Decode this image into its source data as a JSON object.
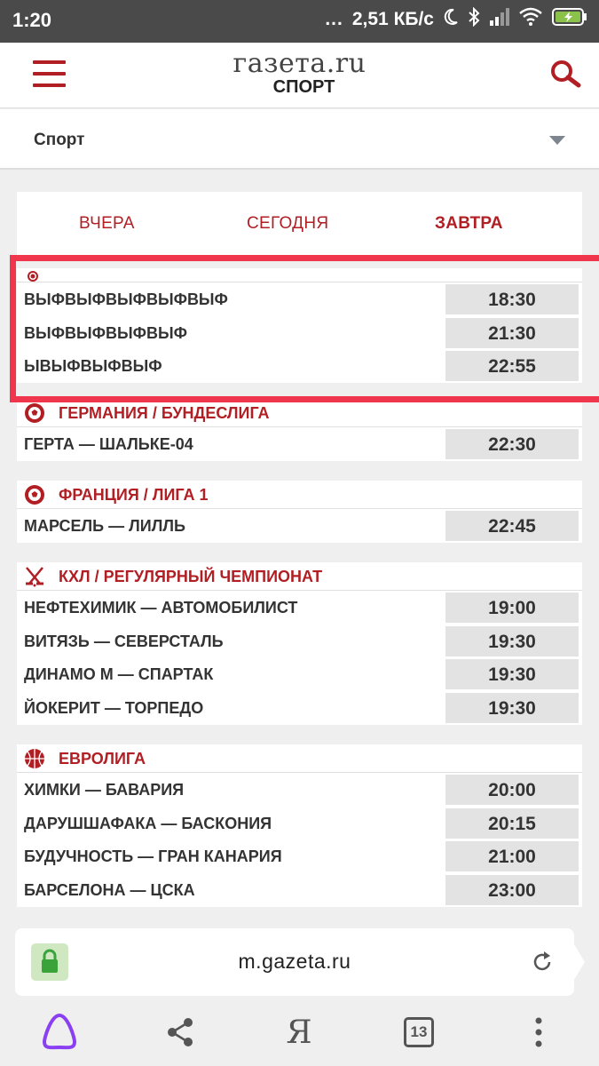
{
  "status_bar": {
    "time": "1:20",
    "dots": "...",
    "speed": "2,51 КБ/с",
    "icons": [
      "moon-icon",
      "bluetooth-icon",
      "signal-icon",
      "wifi-icon",
      "battery-charging-icon"
    ]
  },
  "header": {
    "logo_main": "газета.ru",
    "logo_sub": "СПОРТ",
    "menu_icon": "hamburger-icon",
    "search_icon": "search-icon",
    "brand_color": "#b11f24"
  },
  "category": {
    "selected": "Спорт"
  },
  "tabs": [
    {
      "label": "ВЧЕРА",
      "active": false
    },
    {
      "label": "СЕГОДНЯ",
      "active": false
    },
    {
      "label": "ЗАВТРА",
      "active": true
    }
  ],
  "blocks": [
    {
      "title": "",
      "icon": "soccer-ball-icon",
      "matches": [
        {
          "name": "ВЫФВЫФВЫФВЫФВЫФ",
          "time": "18:30"
        },
        {
          "name": "ВЫФВЫФВЫФВЫФ",
          "time": "21:30"
        },
        {
          "name": "ЫВЫФВЫФВЫФ",
          "time": "22:55"
        }
      ]
    },
    {
      "title": "ГЕРМАНИЯ / БУНДЕСЛИГА",
      "icon": "soccer-ball-icon",
      "matches": [
        {
          "name": "ГЕРТА — ШАЛЬКЕ-04",
          "time": "22:30"
        }
      ]
    },
    {
      "title": "ФРАНЦИЯ / ЛИГА 1",
      "icon": "soccer-ball-icon",
      "matches": [
        {
          "name": "МАРСЕЛЬ — ЛИЛЛЬ",
          "time": "22:45"
        }
      ]
    },
    {
      "title": "КХЛ / РЕГУЛЯРНЫЙ ЧЕМПИОНАТ",
      "icon": "hockey-sticks-icon",
      "matches": [
        {
          "name": "НЕФТЕХИМИК — АВТОМОБИЛИСТ",
          "time": "19:00"
        },
        {
          "name": "ВИТЯЗЬ — СЕВЕРСТАЛЬ",
          "time": "19:30"
        },
        {
          "name": "ДИНАМО М — СПАРТАК",
          "time": "19:30"
        },
        {
          "name": "ЙОКЕРИТ — ТОРПЕДО",
          "time": "19:30"
        }
      ]
    },
    {
      "title": "ЕВРОЛИГА",
      "icon": "basketball-icon",
      "matches": [
        {
          "name": "ХИМКИ — БАВАРИЯ",
          "time": "20:00"
        },
        {
          "name": "ДАРУШШАФАКА — БАСКОНИЯ",
          "time": "20:15"
        },
        {
          "name": "БУДУЧНОСТЬ — ГРАН КАНАРИЯ",
          "time": "21:00"
        },
        {
          "name": "БАРСЕЛОНА — ЦСКА",
          "time": "23:00"
        }
      ]
    }
  ],
  "browser": {
    "url": "m.gazeta.ru",
    "tab_count": "13",
    "ya_letter": "Я",
    "highlight_color": "#f0364c"
  }
}
